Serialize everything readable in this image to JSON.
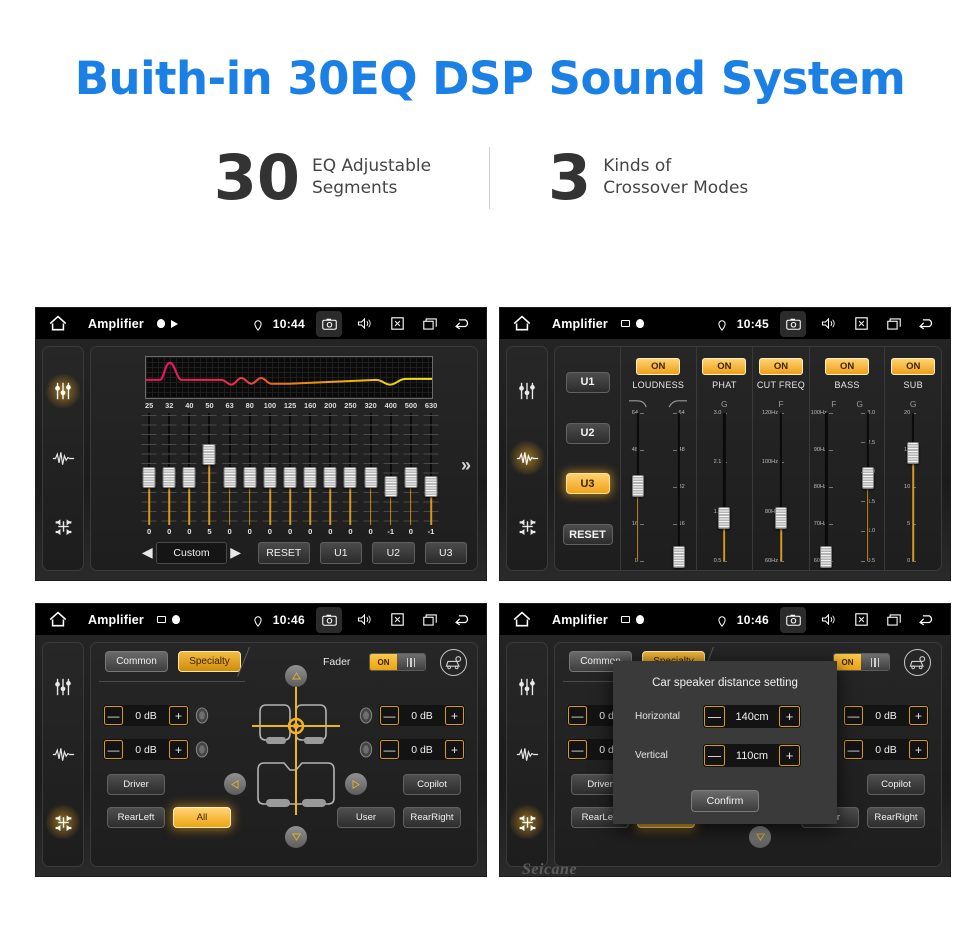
{
  "hero": {
    "title": "Buith-in 30EQ DSP Sound System",
    "stats": [
      {
        "number": "30",
        "line1": "EQ Adjustable",
        "line2": "Segments"
      },
      {
        "number": "3",
        "line1": "Kinds of",
        "line2": "Crossover Modes"
      }
    ]
  },
  "watermark": "Seicane",
  "screens": {
    "eq": {
      "statusbar": {
        "title": "Amplifier",
        "time": "10:44",
        "icons": [
          "home-icon",
          "dot-icon",
          "play-icon",
          "location-pin-icon",
          "camera-icon",
          "volume-icon",
          "close-box-icon",
          "recents-icon",
          "back-icon"
        ]
      },
      "sidebar": [
        {
          "name": "equalizer-icon",
          "active": true
        },
        {
          "name": "waveform-icon",
          "active": false
        },
        {
          "name": "balance-icon",
          "active": false
        }
      ],
      "frequencies": [
        "25",
        "32",
        "40",
        "50",
        "63",
        "80",
        "100",
        "125",
        "160",
        "200",
        "250",
        "320",
        "400",
        "500",
        "630"
      ],
      "values": [
        "0",
        "0",
        "0",
        "5",
        "0",
        "0",
        "0",
        "0",
        "0",
        "0",
        "0",
        "0",
        "-1",
        "0",
        "-1"
      ],
      "knob_pos": [
        48,
        48,
        48,
        28,
        48,
        48,
        48,
        48,
        48,
        48,
        48,
        48,
        56,
        48,
        56
      ],
      "chevron": "»",
      "prev_arrow": "◀",
      "next_arrow": "▶",
      "preset": "Custom",
      "reset_label": "RESET",
      "user_presets": [
        "U1",
        "U2",
        "U3"
      ]
    },
    "crossover": {
      "statusbar": {
        "title": "Amplifier",
        "time": "10:45"
      },
      "sidebar": [
        {
          "name": "equalizer-icon",
          "active": false
        },
        {
          "name": "waveform-icon",
          "active": true
        },
        {
          "name": "balance-icon",
          "active": false
        }
      ],
      "user_presets": [
        "U1",
        "U2",
        "U3"
      ],
      "active_preset": "U3",
      "reset_label": "RESET",
      "columns": [
        {
          "name": "LOUDNESS",
          "on": "ON",
          "symbols": [
            "curve-down-icon",
            "curve-up-icon"
          ],
          "sliders": [
            {
              "scale": [
                "64",
                "48",
                "32",
                "16",
                "0"
              ],
              "side": "left",
              "knob": 42,
              "fill": true
            },
            {
              "scale": [
                "64",
                "48",
                "32",
                "16",
                "0"
              ],
              "side": "right",
              "knob": 88,
              "fill": false
            }
          ]
        },
        {
          "name": "PHAT",
          "on": "ON",
          "symbols": [
            "G"
          ],
          "sliders": [
            {
              "scale": [
                "3.0",
                "2.1",
                "1.3",
                "0.5"
              ],
              "side": "left",
              "knob": 63,
              "fill": true
            }
          ]
        },
        {
          "name": "CUT FREQ",
          "on": "ON",
          "symbols": [
            "F"
          ],
          "sliders": [
            {
              "scale": [
                "120Hz",
                "100Hz",
                "80Hz",
                "60Hz"
              ],
              "side": "left",
              "knob": 63,
              "fill": true
            }
          ]
        },
        {
          "name": "BASS",
          "on": "ON",
          "symbols": [
            "F",
            "G"
          ],
          "sliders": [
            {
              "scale": [
                "100Hz",
                "90Hz",
                "80Hz",
                "70Hz",
                "60Hz"
              ],
              "side": "left",
              "knob": 88,
              "fill": false
            },
            {
              "scale": [
                "3.0",
                "2.5",
                "2.0",
                "1.5",
                "1.0",
                "0.5"
              ],
              "side": "right",
              "knob": 37,
              "fill": true
            }
          ]
        },
        {
          "name": "SUB",
          "on": "ON",
          "symbols": [
            "G"
          ],
          "sliders": [
            {
              "scale": [
                "20",
                "15",
                "10",
                "5",
                "0"
              ],
              "side": "left",
              "knob": 21,
              "fill": true
            }
          ]
        }
      ]
    },
    "fader": {
      "statusbar": {
        "title": "Amplifier",
        "time": "10:46"
      },
      "sidebar": [
        {
          "name": "equalizer-icon",
          "active": false
        },
        {
          "name": "waveform-icon",
          "active": false
        },
        {
          "name": "balance-icon",
          "active": true
        }
      ],
      "tabs": [
        {
          "label": "Common",
          "active": false
        },
        {
          "label": "Specialty",
          "active": true
        }
      ],
      "fader_label": "Fader",
      "fader_toggle": "ON",
      "gear_icon": "car-settings-icon",
      "db_values": [
        "0 dB",
        "0 dB",
        "0 dB",
        "0 dB"
      ],
      "minus": "—",
      "plus": "+",
      "seat_buttons": [
        {
          "label": "Driver",
          "active": false
        },
        {
          "label": "Copilot",
          "active": false
        },
        {
          "label": "RearLeft",
          "active": false
        },
        {
          "label": "All",
          "active": true
        },
        {
          "label": "User",
          "active": false
        },
        {
          "label": "RearRight",
          "active": false
        }
      ]
    },
    "dialog": {
      "statusbar": {
        "title": "Amplifier",
        "time": "10:46"
      },
      "title": "Car speaker distance setting",
      "rows": [
        {
          "label": "Horizontal",
          "value": "140cm"
        },
        {
          "label": "Vertical",
          "value": "110cm"
        }
      ],
      "confirm_label": "Confirm",
      "minus": "—",
      "plus": "+"
    }
  }
}
